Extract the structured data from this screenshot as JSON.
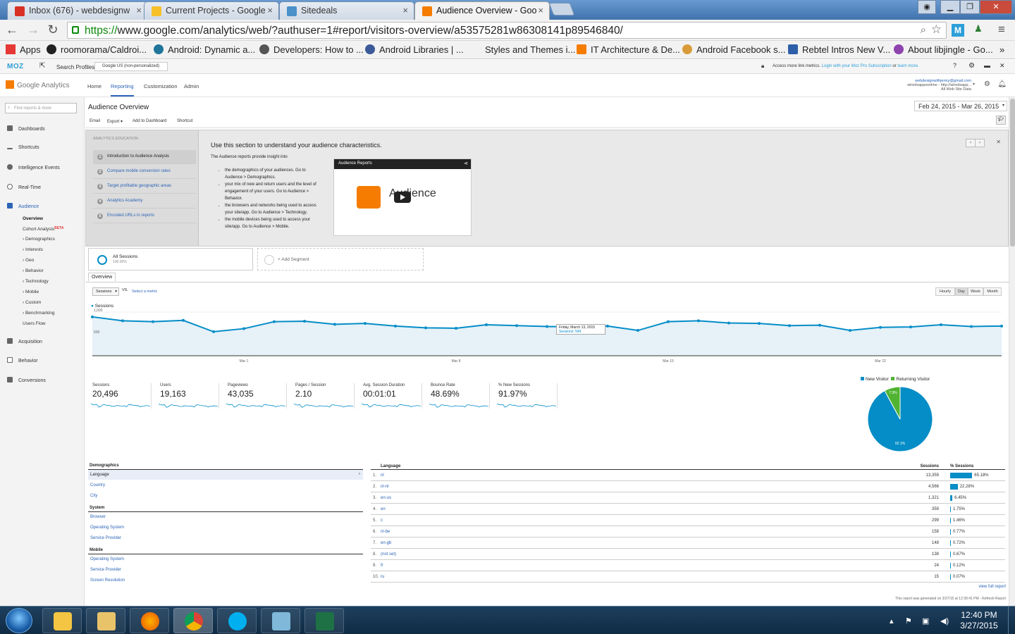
{
  "browser": {
    "tabs": [
      {
        "label": "Inbox (676) - webdesignw",
        "color": "#d93025"
      },
      {
        "label": "Current Projects - Google",
        "color": "#4c8bf5"
      },
      {
        "label": "Sitedeals",
        "color": "#4a90c9"
      },
      {
        "label": "Audience Overview - Goo",
        "color": "#f57c00"
      }
    ],
    "url_scheme": "https://",
    "url_rest": "www.google.com/analytics/web/?authuser=1#report/visitors-overview/a53575281w86308141p89546840/",
    "bookmarks": [
      {
        "label": "Apps",
        "color": "#e53935"
      },
      {
        "label": "roomorama/Caldroi...",
        "color": "#222"
      },
      {
        "label": "Android: Dynamic a...",
        "color": "#21759b"
      },
      {
        "label": "Developers: How to ...",
        "color": "#555"
      },
      {
        "label": "Android Libraries | ...",
        "color": "#3b5998"
      },
      {
        "label": "Styles and Themes i...",
        "color": "#f2f2f2"
      },
      {
        "label": "IT Architecture & De...",
        "color": "#f57c00"
      },
      {
        "label": "Android Facebook s...",
        "color": "#d99b3a"
      },
      {
        "label": "Rebtel Intros New V...",
        "color": "#2d5fa8"
      },
      {
        "label": "About libjingle - Go...",
        "color": "#8e44ad"
      }
    ]
  },
  "moz": {
    "logo": "MOZ",
    "search_profiles": "Search Profiles",
    "engine": "Google US (non-personalized)",
    "notice": "Access more link metrics.",
    "notice_link": "Login with your Moz Pro Subscription",
    "notice_or": "or",
    "learn_more": "learn more."
  },
  "ga": {
    "logo": "Google Analytics",
    "nav": [
      "Home",
      "Reporting",
      "Customization",
      "Admin"
    ],
    "account_email": "webdesignwithjenny@gmail.com",
    "account_sub": "wiredsappsonline - http://wiredsapp...",
    "account_view": "All Web Site Data"
  },
  "sidebar": {
    "find_placeholder": "Find reports & more",
    "items": [
      "Dashboards",
      "Shortcuts",
      "Intelligence Events",
      "Real-Time",
      "Audience",
      "Acquisition",
      "Behavior",
      "Conversions"
    ],
    "audience_sub": [
      "Overview",
      "Cohort Analysis",
      "› Demographics",
      "› Interests",
      "› Geo",
      "› Behavior",
      "› Technology",
      "› Mobile",
      "› Custom",
      "› Benchmarking",
      "Users Flow"
    ],
    "beta": "BETA"
  },
  "page": {
    "title": "Audience Overview",
    "date_range": "Feb 24, 2015 - Mar 26, 2015",
    "actions": [
      "Email",
      "Export ▾",
      "Add to Dashboard",
      "Shortcut"
    ]
  },
  "education": {
    "header": "ANALYTICS EDUCATION",
    "lessons": [
      "Introduction to Audience Analysis",
      "Compare mobile conversion rates",
      "Target profitable geographic areas",
      "Analytics Academy",
      "Encoded URLs in reports"
    ],
    "heading": "Use this section to understand your audience characteristics.",
    "intro": "The Audience reports provide insight into",
    "bullets": [
      "the demographics of your audiences. Go to Audience > Demographics.",
      "your mix of new and return users and the level of engagement of your users. Go to Audience > Behavior.",
      "the browsers and networks being used to access your site/app. Go to Audience > Technology.",
      "the mobile devices being used to access your site/app. Go to Audience > Mobile."
    ],
    "video_title": "Audience Reports",
    "video_text": "Audience"
  },
  "segments": {
    "all_label": "All Sessions",
    "all_pct": "100.00%",
    "add_label": "+ Add Segment"
  },
  "overview": {
    "tab": "Overview",
    "metric_select": "Sessions",
    "vs": "VS.",
    "select_metric": "Select a metric",
    "time_buttons": [
      "Hourly",
      "Day",
      "Week",
      "Month"
    ],
    "active_time": "Day",
    "series_label": "Sessions",
    "tooltip_date": "Friday, March 13, 2015",
    "tooltip_value": "Sessions: 549"
  },
  "chart_data": {
    "type": "area",
    "title": "",
    "series": [
      {
        "name": "Sessions",
        "values": [
          890,
          800,
          780,
          810,
          550,
          620,
          780,
          790,
          720,
          740,
          680,
          640,
          630,
          710,
          690,
          670,
          660,
          680,
          580,
          780,
          800,
          750,
          740,
          690,
          700,
          580,
          650,
          660,
          710,
          670,
          680
        ]
      }
    ],
    "x_ticks": [
      "Mar 1",
      "Mar 8",
      "Mar 15",
      "Mar 22"
    ],
    "y_ticks": [
      "1,000",
      "500"
    ],
    "ylim": [
      0,
      1000
    ]
  },
  "metrics": [
    {
      "label": "Sessions",
      "value": "20,496"
    },
    {
      "label": "Users",
      "value": "19,163"
    },
    {
      "label": "Pageviews",
      "value": "43,035"
    },
    {
      "label": "Pages / Session",
      "value": "2.10"
    },
    {
      "label": "Avg. Session Duration",
      "value": "00:01:01"
    },
    {
      "label": "Bounce Rate",
      "value": "48.69%"
    },
    {
      "label": "% New Sessions",
      "value": "91.97%"
    }
  ],
  "pie": {
    "legend": [
      {
        "label": "New Visitor",
        "color": "#058dc7"
      },
      {
        "label": "Returning Visitor",
        "color": "#50b432"
      }
    ],
    "new_pct": 92.1,
    "new_label": "92.1%",
    "ret_label": "7.9%"
  },
  "demographics": {
    "heading": "Demographics",
    "selected": "Language",
    "demo_links": [
      "Country",
      "City"
    ],
    "system_heading": "System",
    "system_links": [
      "Browser",
      "Operating System",
      "Service Provider"
    ],
    "mobile_heading": "Mobile",
    "mobile_links": [
      "Operating System",
      "Service Provider",
      "Screen Resolution"
    ]
  },
  "language_table": {
    "col_language": "Language",
    "col_sessions": "Sessions",
    "col_pct": "% Sessions",
    "rows": [
      {
        "idx": "1.",
        "lang": "nl",
        "sessions": "13,359",
        "pct": "65.18%",
        "frac": 0.6518
      },
      {
        "idx": "2.",
        "lang": "nl-nl",
        "sessions": "4,566",
        "pct": "22.28%",
        "frac": 0.2228
      },
      {
        "idx": "3.",
        "lang": "en-us",
        "sessions": "1,321",
        "pct": "6.45%",
        "frac": 0.0645
      },
      {
        "idx": "4.",
        "lang": "en",
        "sessions": "359",
        "pct": "1.75%",
        "frac": 0.0175
      },
      {
        "idx": "5.",
        "lang": "c",
        "sessions": "299",
        "pct": "1.46%",
        "frac": 0.0146
      },
      {
        "idx": "6.",
        "lang": "nl-be",
        "sessions": "158",
        "pct": "0.77%",
        "frac": 0.0077
      },
      {
        "idx": "7.",
        "lang": "en-gb",
        "sessions": "148",
        "pct": "0.72%",
        "frac": 0.0072
      },
      {
        "idx": "8.",
        "lang": "(not set)",
        "sessions": "138",
        "pct": "0.67%",
        "frac": 0.0067
      },
      {
        "idx": "9.",
        "lang": "fr",
        "sessions": "24",
        "pct": "0.12%",
        "frac": 0.0012
      },
      {
        "idx": "10.",
        "lang": "ru",
        "sessions": "15",
        "pct": "0.07%",
        "frac": 0.0007
      }
    ],
    "view_full": "view full report",
    "footnote": "This report was generated on 3/27/15 at 12:39:41 PM - Refresh Report"
  },
  "taskbar": {
    "time": "12:40 PM",
    "date": "3/27/2015"
  }
}
